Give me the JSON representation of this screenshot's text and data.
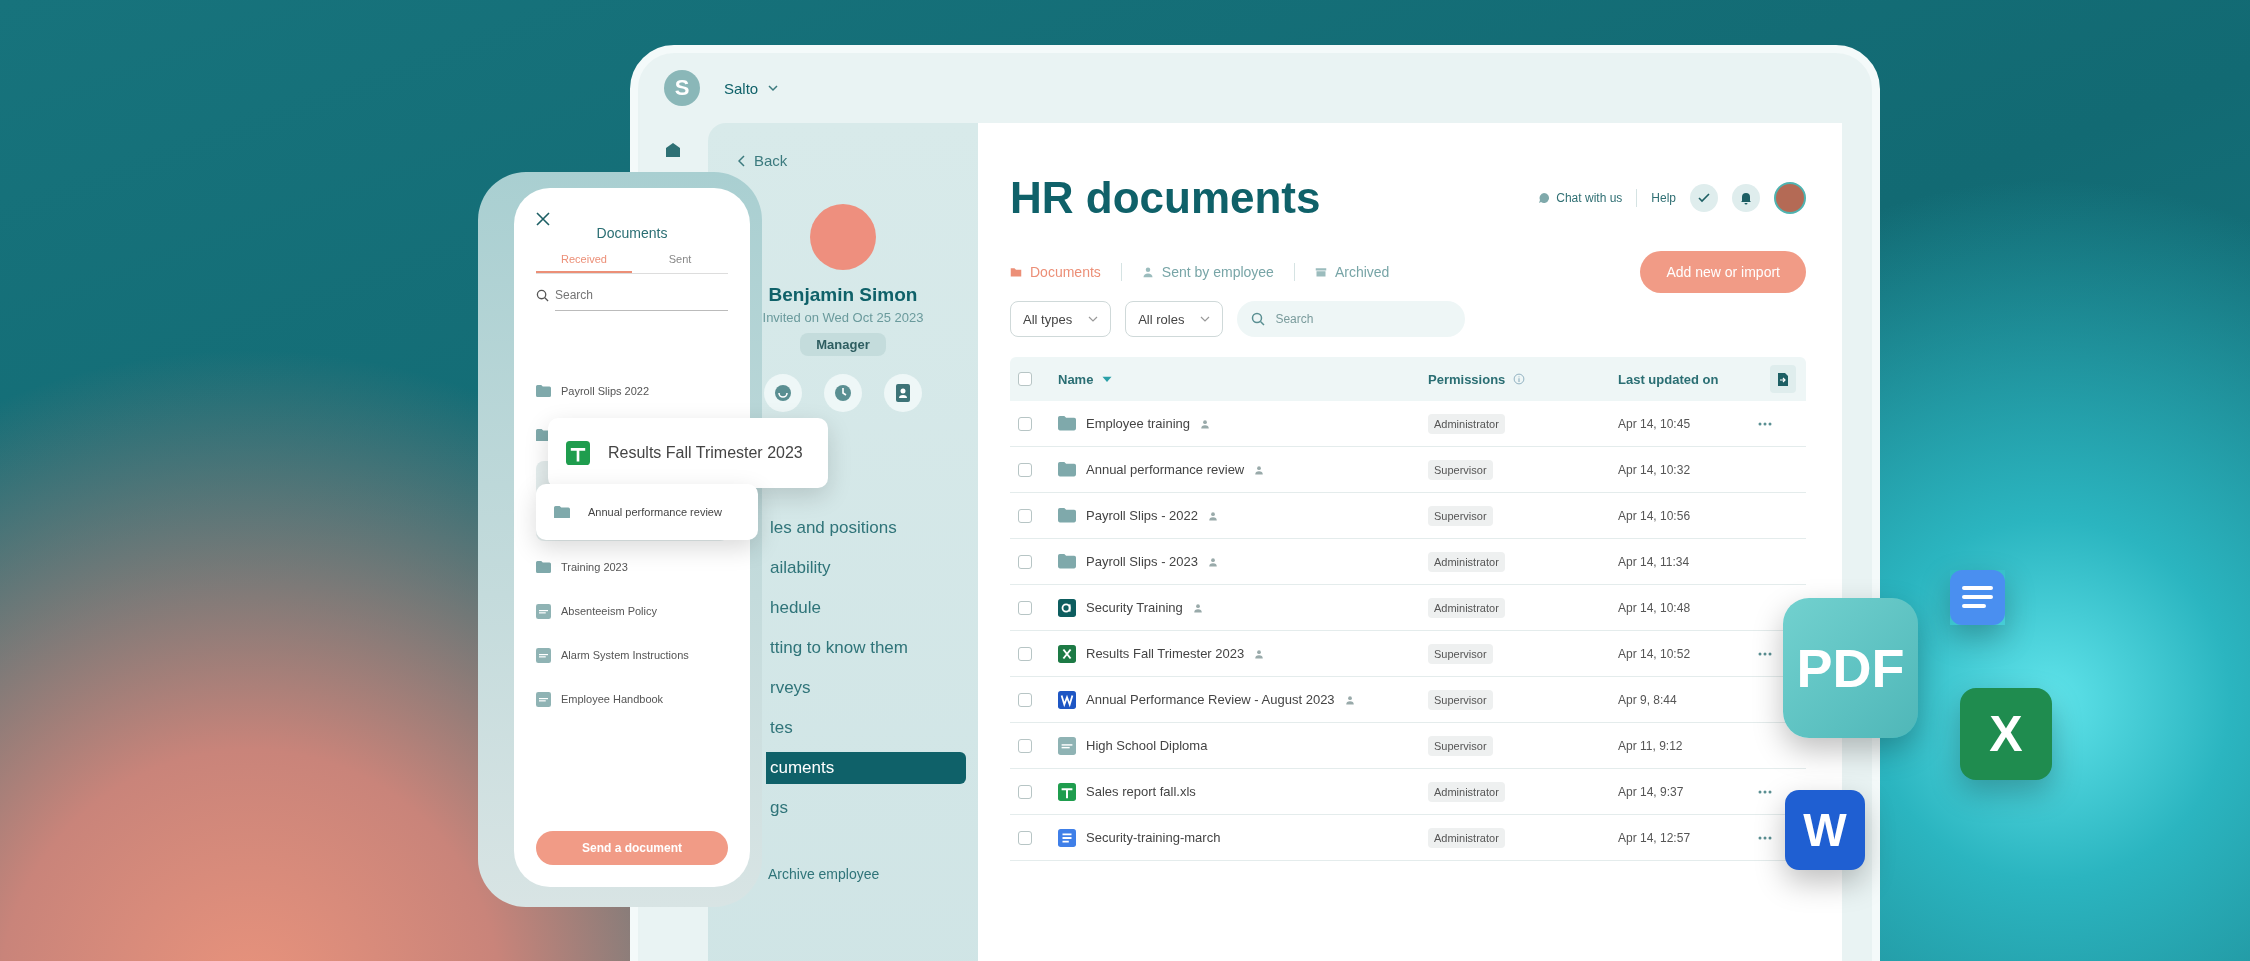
{
  "tablet": {
    "workspace": {
      "logo_letter": "S",
      "name": "Salto"
    },
    "profile": {
      "back": "Back",
      "name": "Benjamin Simon",
      "invited": "Invited on Wed Oct 25 2023",
      "role": "Manager",
      "nav": [
        {
          "label": "les and positions",
          "selected": false
        },
        {
          "label": "ailability",
          "selected": false
        },
        {
          "label": "hedule",
          "selected": false
        },
        {
          "label": "tting to know them",
          "selected": false
        },
        {
          "label": "rveys",
          "selected": false
        },
        {
          "label": "tes",
          "selected": false
        },
        {
          "label": "cuments",
          "selected": true
        },
        {
          "label": "gs",
          "selected": false
        }
      ],
      "archive": "Archive employee"
    },
    "main": {
      "title": "HR documents",
      "chat": "Chat with us",
      "help": "Help",
      "tabs": [
        {
          "label": "Documents",
          "kind": "folder",
          "selected": true
        },
        {
          "label": "Sent by employee",
          "kind": "person",
          "selected": false
        },
        {
          "label": "Archived",
          "kind": "archive",
          "selected": false
        }
      ],
      "add_button": "Add new or import",
      "filters": [
        "All types",
        "All roles"
      ],
      "search": {
        "placeholder": "Search"
      },
      "table": {
        "columns": [
          "Name",
          "Permissions",
          "Last updated on"
        ],
        "select_all_checked": false,
        "rows": [
          {
            "kind": "folder",
            "name": "Employee training",
            "shared": true,
            "permission": "Administrator",
            "updated": "Apr 14, 10:45",
            "menu": true,
            "checked": false
          },
          {
            "kind": "folder",
            "name": "Annual performance review",
            "shared": true,
            "permission": "Supervisor",
            "updated": "Apr 14, 10:32",
            "menu": false,
            "checked": false
          },
          {
            "kind": "folder",
            "name": "Payroll Slips - 2022",
            "shared": true,
            "permission": "Supervisor",
            "updated": "Apr 14, 10:56",
            "menu": false,
            "checked": false
          },
          {
            "kind": "folder",
            "name": "Payroll Slips - 2023",
            "shared": true,
            "permission": "Administrator",
            "updated": "Apr 14, 11:34",
            "menu": false,
            "checked": false
          },
          {
            "kind": "alpha",
            "name": "Security Training",
            "shared": true,
            "permission": "Administrator",
            "updated": "Apr 14, 10:48",
            "menu": false,
            "checked": false
          },
          {
            "kind": "excel",
            "name": "Results Fall Trimester 2023",
            "shared": true,
            "permission": "Supervisor",
            "updated": "Apr 14, 10:52",
            "menu": true,
            "checked": false
          },
          {
            "kind": "word",
            "name": "Annual Performance Review - August 2023",
            "shared": true,
            "permission": "Supervisor",
            "updated": "Apr 9, 8:44",
            "menu": false,
            "checked": false
          },
          {
            "kind": "pdf",
            "name": "High School Diploma",
            "shared": false,
            "permission": "Supervisor",
            "updated": "Apr 11, 9:12",
            "menu": false,
            "checked": false
          },
          {
            "kind": "sheets",
            "name": "Sales report fall.xls",
            "shared": false,
            "permission": "Administrator",
            "updated": "Apr 14, 9:37",
            "menu": true,
            "checked": false
          },
          {
            "kind": "docs",
            "name": "Security-training-march",
            "shared": false,
            "permission": "Administrator",
            "updated": "Apr 14, 12:57",
            "menu": true,
            "checked": false
          }
        ]
      }
    }
  },
  "phone": {
    "title": "Documents",
    "tabs": [
      {
        "label": "Received",
        "selected": true
      },
      {
        "label": "Sent",
        "selected": false
      }
    ],
    "search": {
      "placeholder": "Search"
    },
    "items": [
      {
        "kind": "folder",
        "label": "Payroll Slips 2022"
      },
      {
        "kind": "folder-hidden"
      },
      {
        "kind": "slot"
      },
      {
        "kind": "slot"
      },
      {
        "kind": "folder",
        "label": "Training 2023"
      },
      {
        "kind": "pdf",
        "label": "Absenteeism Policy"
      },
      {
        "kind": "pdf",
        "label": "Alarm System Instructions"
      },
      {
        "kind": "pdf",
        "label": "Employee Handbook"
      }
    ],
    "button": "Send a document",
    "drag_cards": [
      {
        "kind": "sheets",
        "label": "Results Fall Trimester 2023"
      },
      {
        "kind": "folder",
        "label": "Annual performance review"
      }
    ]
  },
  "floating_tiles": [
    {
      "kind": "docs"
    },
    {
      "kind": "pdf",
      "label": "PDF"
    },
    {
      "kind": "excel",
      "label": "X"
    },
    {
      "kind": "word",
      "label": "W"
    }
  ]
}
